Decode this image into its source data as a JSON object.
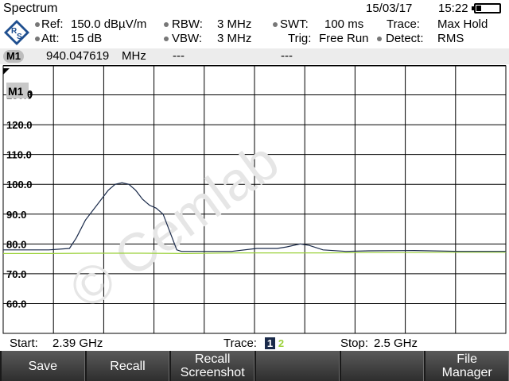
{
  "header": {
    "title": "Spectrum",
    "date": "15/03/17",
    "time": "15:22",
    "ref_label": "Ref:",
    "ref_value": "150.0 dBµV/m",
    "att_label": "Att:",
    "att_value": "15 dB",
    "rbw_label": "RBW:",
    "rbw_value": "3 MHz",
    "vbw_label": "VBW:",
    "vbw_value": "3 MHz",
    "swt_label": "SWT:",
    "swt_value": "100 ms",
    "trig_label": "Trig:",
    "trig_value": "Free Run",
    "trace_label": "Trace:",
    "trace_value": "Max Hold",
    "detect_label": "Detect:",
    "detect_value": "RMS"
  },
  "marker": {
    "badge": "M1",
    "frequency": "940.047619",
    "unit": "MHz",
    "field2": "---",
    "field3": "---"
  },
  "plot": {
    "marker_label": "M1",
    "top_label_partial": "0",
    "y_labels": [
      "130.0",
      "120.0",
      "110.0",
      "100.0",
      "90.0",
      "80.0",
      "70.0",
      "60.0"
    ],
    "watermark": "© Cemlab"
  },
  "footer": {
    "start_label": "Start:",
    "start_value": "2.39 GHz",
    "trace_label": "Trace:",
    "trace1": "1",
    "trace2": "2",
    "stop_label": "Stop:",
    "stop_value": "2.5 GHz"
  },
  "softkeys": [
    "Save",
    "Recall",
    "Recall\nScreenshot",
    "",
    "",
    "File\nManager"
  ],
  "colors": {
    "trace1": "#1a2a4a",
    "trace2": "#9bd13a",
    "softkey_bg": "#3a3a3a",
    "logo": "#1f4f8f"
  },
  "chart_data": {
    "type": "line",
    "x_start_ghz": 2.39,
    "x_stop_ghz": 2.5,
    "ylim": [
      50,
      140
    ],
    "yticks": [
      60,
      70,
      80,
      90,
      100,
      110,
      120,
      130
    ],
    "series": [
      {
        "x": [
          2.39,
          2.4,
          2.4045,
          2.406,
          2.408,
          2.41,
          2.4115,
          2.413,
          2.4145,
          2.416,
          2.4175,
          2.419,
          2.4205,
          2.422,
          2.4235,
          2.425,
          2.4265,
          2.428,
          2.429,
          2.43,
          2.434,
          2.44,
          2.4455,
          2.45,
          2.452,
          2.455,
          2.457,
          2.46,
          2.465,
          2.47,
          2.48,
          2.49,
          2.5
        ],
        "y": [
          78,
          78,
          78.5,
          82,
          88,
          92,
          95,
          98,
          100,
          100.5,
          100,
          98,
          95,
          93,
          92,
          90,
          84,
          78,
          77.5,
          77.5,
          77.5,
          77.5,
          78.5,
          78.5,
          79,
          80,
          79.5,
          78,
          77.5,
          77.7,
          77.8,
          77.5,
          77.5
        ]
      },
      {
        "x": [
          2.39,
          2.4,
          2.41,
          2.42,
          2.43,
          2.44,
          2.45,
          2.46,
          2.47,
          2.48,
          2.49,
          2.5
        ],
        "y": [
          76.8,
          76.8,
          76.9,
          76.9,
          76.8,
          77,
          77,
          77,
          77.1,
          77.1,
          77.2,
          77.2
        ]
      }
    ]
  }
}
